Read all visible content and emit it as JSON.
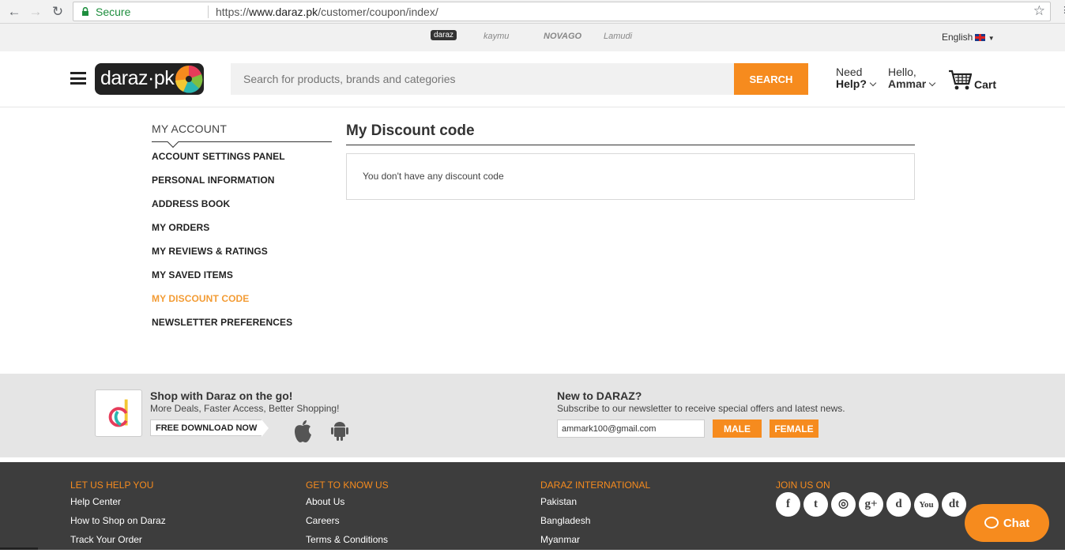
{
  "browser": {
    "secure_label": "Secure",
    "url_scheme": "https://",
    "url_host": "www.daraz.pk",
    "url_path": "/customer/coupon/index/"
  },
  "ventures": {
    "active": "daraz",
    "items": [
      "kaymu",
      "NOVAGO",
      "Lamudi"
    ]
  },
  "language": "English",
  "header": {
    "logo_text": "daraz·pk",
    "search_placeholder": "Search for products, brands and categories",
    "search_button": "SEARCH",
    "help_line1": "Need",
    "help_line2": "Help?",
    "hello_line1": "Hello,",
    "hello_line2": "Ammar",
    "cart_label": "Cart"
  },
  "sidebar": {
    "title": "MY ACCOUNT",
    "items": [
      "ACCOUNT SETTINGS PANEL",
      "PERSONAL INFORMATION",
      "ADDRESS BOOK",
      "MY ORDERS",
      "MY REVIEWS & RATINGS",
      "MY SAVED ITEMS",
      "MY DISCOUNT CODE",
      "NEWSLETTER PREFERENCES"
    ],
    "active_index": 6
  },
  "main": {
    "title": "My Discount code",
    "empty_message": "You don't have any discount code"
  },
  "app_band": {
    "title": "Shop with Daraz on the go!",
    "subtitle": "More Deals, Faster Access, Better Shopping!",
    "download_button": "FREE DOWNLOAD NOW",
    "news_title": "New to DARAZ?",
    "news_subtitle": "Subscribe to our newsletter to receive special offers and latest news.",
    "email_value": "ammark100@gmail.com",
    "male_button": "MALE",
    "female_button": "FEMALE"
  },
  "footer": {
    "col1_title": "LET US HELP YOU",
    "col1_links": [
      "Help Center",
      "How to Shop on Daraz",
      "Track Your Order"
    ],
    "col2_title": "GET TO KNOW US",
    "col2_links": [
      "About Us",
      "Careers",
      "Terms & Conditions"
    ],
    "col3_title": "DARAZ INTERNATIONAL",
    "col3_links": [
      "Pakistan",
      "Bangladesh",
      "Myanmar"
    ],
    "col4_title": "JOIN US ON",
    "socials": [
      "facebook",
      "twitter",
      "instagram",
      "google-plus",
      "daraz",
      "youtube",
      "dt"
    ],
    "social_glyphs": [
      "f",
      "t",
      "◎",
      "g+",
      "d",
      "You",
      "dt"
    ]
  },
  "chat_label": "Chat",
  "colors": {
    "accent": "#f68b1e",
    "active_menu": "#f39c35",
    "footer_bg": "#3d3d3d",
    "secure_green": "#1e8e3e"
  }
}
